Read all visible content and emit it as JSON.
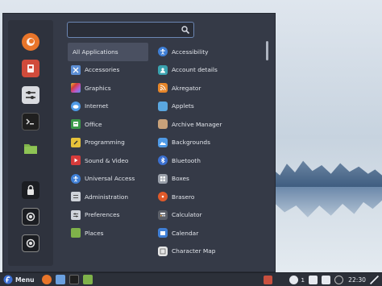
{
  "search": {
    "value": "",
    "placeholder": ""
  },
  "favorites": [
    {
      "icon": "firefox-icon",
      "color": "#e8752a"
    },
    {
      "icon": "software-manager-icon",
      "color": "#d04b3b"
    },
    {
      "icon": "settings-icon",
      "color": "#d9dbe0"
    },
    {
      "icon": "terminal-icon",
      "color": "#1f1f1f"
    },
    {
      "icon": "files-icon",
      "color": "#7fb24a"
    },
    {
      "icon": "lock-screen-icon",
      "color": "#1b1d22"
    },
    {
      "icon": "logout-icon",
      "color": "#1b1d22"
    },
    {
      "icon": "power-icon",
      "color": "#1b1d22"
    }
  ],
  "categories": [
    {
      "label": "All Applications",
      "icon": "",
      "color": "",
      "active": true
    },
    {
      "label": "Accessories",
      "icon": "accessories-icon",
      "color": "#5c8fd6"
    },
    {
      "label": "Graphics",
      "icon": "graphics-icon",
      "color": "#b85ad0"
    },
    {
      "label": "Internet",
      "icon": "internet-icon",
      "color": "#4f9ae6"
    },
    {
      "label": "Office",
      "icon": "office-icon",
      "color": "#3c9a4a"
    },
    {
      "label": "Programming",
      "icon": "programming-icon",
      "color": "#e6c23a"
    },
    {
      "label": "Sound & Video",
      "icon": "sound-video-icon",
      "color": "#d63b3b"
    },
    {
      "label": "Universal Access",
      "icon": "universal-access-icon",
      "color": "#3f7fd6"
    },
    {
      "label": "Administration",
      "icon": "administration-icon",
      "color": "#cfd3da"
    },
    {
      "label": "Preferences",
      "icon": "preferences-icon",
      "color": "#cfd3da"
    },
    {
      "label": "Places",
      "icon": "places-icon",
      "color": "#7fb24a"
    }
  ],
  "apps": [
    {
      "label": "Accessibility",
      "icon": "accessibility-icon",
      "color": "#3f7fd6"
    },
    {
      "label": "Account details",
      "icon": "account-details-icon",
      "color": "#3aa3b0"
    },
    {
      "label": "Akregator",
      "icon": "akregator-icon",
      "color": "#e6862a"
    },
    {
      "label": "Applets",
      "icon": "applets-icon",
      "color": "#5aa7e0"
    },
    {
      "label": "Archive Manager",
      "icon": "archive-manager-icon",
      "color": "#c9a27a"
    },
    {
      "label": "Backgrounds",
      "icon": "backgrounds-icon",
      "color": "#4f9ae6"
    },
    {
      "label": "Bluetooth",
      "icon": "bluetooth-icon",
      "color": "#3a6fd0"
    },
    {
      "label": "Boxes",
      "icon": "boxes-icon",
      "color": "#9aa0aa"
    },
    {
      "label": "Brasero",
      "icon": "brasero-icon",
      "color": "#e05a2a"
    },
    {
      "label": "Calculator",
      "icon": "calculator-icon",
      "color": "#5b5f68"
    },
    {
      "label": "Calendar",
      "icon": "calendar-icon",
      "color": "#3f7fd6"
    },
    {
      "label": "Character Map",
      "icon": "character-map-icon",
      "color": "#e6e6e6"
    }
  ],
  "taskbar": {
    "menu_label": "Menu",
    "launchers": [
      {
        "icon": "firefox-icon",
        "color": "#e8752a"
      },
      {
        "icon": "text-editor-icon",
        "color": "#6aa0e0"
      },
      {
        "icon": "terminal-icon",
        "color": "#1f1f1f"
      },
      {
        "icon": "files-icon",
        "color": "#7fb24a"
      }
    ],
    "tray": {
      "update_count": "1",
      "clock": "22:30"
    }
  }
}
